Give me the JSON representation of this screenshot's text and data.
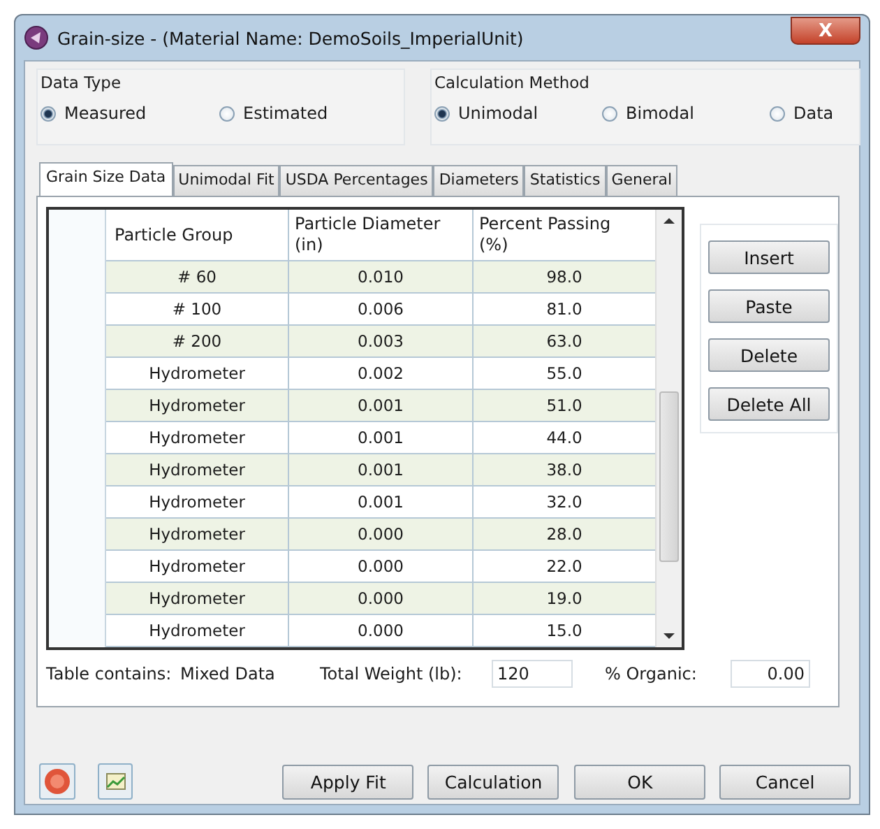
{
  "window": {
    "title": "Grain-size - (Material Name: DemoSoils_ImperialUnit)",
    "close": "X"
  },
  "groups": [
    {
      "title": "Data Type",
      "options": [
        {
          "label": "Measured",
          "selected": true
        },
        {
          "label": "Estimated",
          "selected": false
        }
      ]
    },
    {
      "title": "Calculation Method",
      "options": [
        {
          "label": "Unimodal",
          "selected": true
        },
        {
          "label": "Bimodal",
          "selected": false
        },
        {
          "label": "Data",
          "selected": false
        }
      ]
    }
  ],
  "tabs": [
    {
      "label": "Grain Size Data",
      "selected": true
    },
    {
      "label": "Unimodal Fit",
      "selected": false
    },
    {
      "label": "USDA Percentages",
      "selected": false
    },
    {
      "label": "Diameters",
      "selected": false
    },
    {
      "label": "Statistics",
      "selected": false
    },
    {
      "label": "General",
      "selected": false
    }
  ],
  "table": {
    "columns": [
      "Particle Group",
      "Particle Diameter (in)",
      "Percent Passing (%)"
    ],
    "rows": [
      [
        "# 60",
        "0.010",
        "98.0"
      ],
      [
        "# 100",
        "0.006",
        "81.0"
      ],
      [
        "# 200",
        "0.003",
        "63.0"
      ],
      [
        "Hydrometer",
        "0.002",
        "55.0"
      ],
      [
        "Hydrometer",
        "0.001",
        "51.0"
      ],
      [
        "Hydrometer",
        "0.001",
        "44.0"
      ],
      [
        "Hydrometer",
        "0.001",
        "38.0"
      ],
      [
        "Hydrometer",
        "0.001",
        "32.0"
      ],
      [
        "Hydrometer",
        "0.000",
        "28.0"
      ],
      [
        "Hydrometer",
        "0.000",
        "22.0"
      ],
      [
        "Hydrometer",
        "0.000",
        "19.0"
      ],
      [
        "Hydrometer",
        "0.000",
        "15.0"
      ]
    ]
  },
  "side_buttons": [
    "Insert",
    "Paste",
    "Delete",
    "Delete All"
  ],
  "footer": {
    "table_contains": {
      "label": "Table contains:",
      "value": "Mixed Data"
    },
    "total_weight": {
      "label": "Total Weight (lb):",
      "value": "120"
    },
    "organic": {
      "label": "% Organic:",
      "value": "0.00"
    }
  },
  "buttons": [
    "Apply Fit",
    "Calculation",
    "OK",
    "Cancel"
  ]
}
